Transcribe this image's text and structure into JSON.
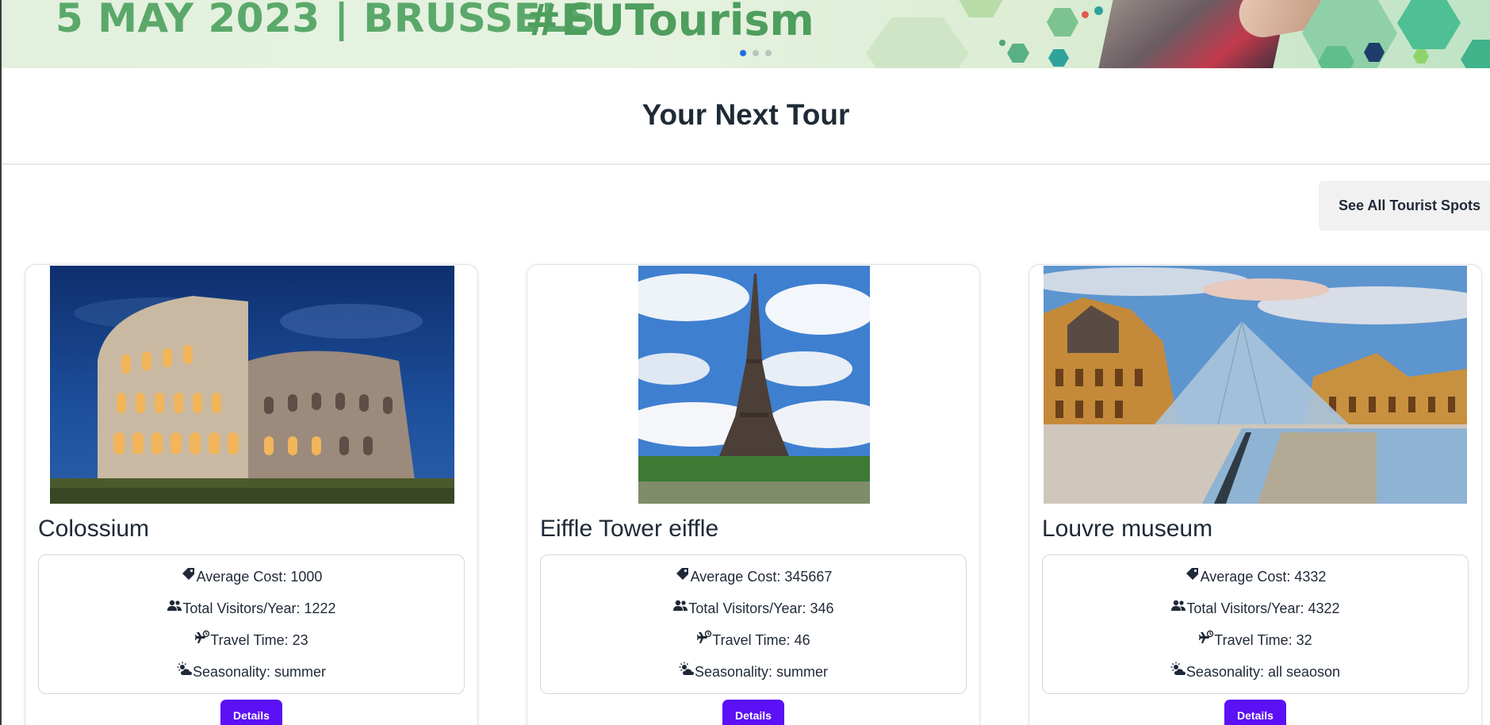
{
  "banner": {
    "date_city": "5 MAY 2023 | BRUSSELS",
    "hashtag": "#EUTourism",
    "slides": 3,
    "active_slide": 1
  },
  "section": {
    "title": "Your Next Tour",
    "see_all_label": "See All Tourist Spots"
  },
  "labels": {
    "cost": "Average Cost: ",
    "visitors": "Total Visitors/Year: ",
    "travel": "Travel Time: ",
    "season": "Seasonality: ",
    "details": "Details"
  },
  "cards": [
    {
      "name": "Colossium",
      "cost": "1000",
      "visitors": "1222",
      "travel": "23",
      "season": "summer"
    },
    {
      "name": "Eiffle Tower eiffle",
      "cost": "345667",
      "visitors": "346",
      "travel": "46",
      "season": "summer"
    },
    {
      "name": "Louvre museum",
      "cost": "4332",
      "visitors": "4322",
      "travel": "32",
      "season": "all seaoson"
    }
  ],
  "colors": {
    "primary_button": "#5b10f5",
    "banner_green": "#5aa96a",
    "indicator_active": "#1e6fe0"
  },
  "icons": [
    "tag-icon",
    "users-icon",
    "plane-clock-icon",
    "sun-cloud-icon"
  ]
}
